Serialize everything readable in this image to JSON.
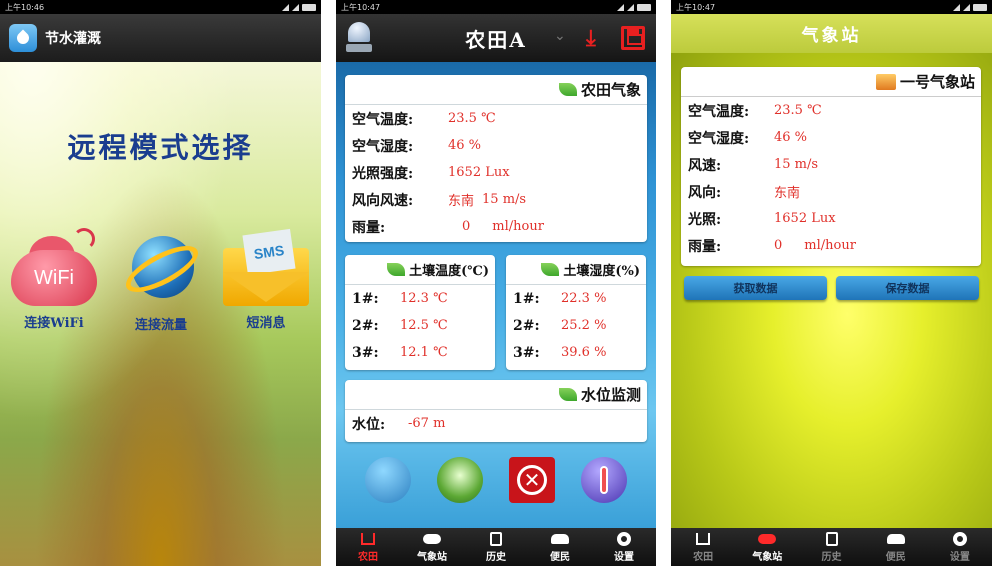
{
  "phone1": {
    "status_time": "上午10:46",
    "app_title": "节水灌溉",
    "heading": "远程模式选择",
    "options": [
      {
        "label": "连接WiFi",
        "icon_text": "WiFi",
        "icon": "wifi-cloud-icon"
      },
      {
        "label": "连接流量",
        "icon": "globe-icon"
      },
      {
        "label": "短消息",
        "icon_text": "SMS",
        "icon": "sms-envelope-icon"
      }
    ],
    "colors": {
      "heading": "#1a3d8f"
    }
  },
  "phone2": {
    "status_time": "上午10:47",
    "title": "农田A",
    "dropdown_glyph": "⌄",
    "download_glyph": "⤓",
    "weather": {
      "title": "农田气象",
      "rows": [
        {
          "k": "空气温度:",
          "v": "23.5 ℃"
        },
        {
          "k": "空气湿度:",
          "v": "46 %"
        },
        {
          "k": "光照强度:",
          "v": "1652 Lux"
        },
        {
          "k": "风向风速:",
          "v": "东南",
          "u": "15 m/s"
        },
        {
          "k": "雨量:",
          "v": "0",
          "u": "ml/hour"
        }
      ]
    },
    "soil_temp": {
      "title": "土壤温度(℃)",
      "rows": [
        {
          "k": "1#:",
          "v": "12.3 ℃"
        },
        {
          "k": "2#:",
          "v": "12.5 ℃"
        },
        {
          "k": "3#:",
          "v": "12.1 ℃"
        }
      ]
    },
    "soil_humid": {
      "title": "土壤湿度(%)",
      "rows": [
        {
          "k": "1#:",
          "v": "22.3 %"
        },
        {
          "k": "2#:",
          "v": "25.2 %"
        },
        {
          "k": "3#:",
          "v": "39.6 %"
        }
      ]
    },
    "water": {
      "title": "水位监测",
      "rows": [
        {
          "k": "水位:",
          "v": "-67 m"
        }
      ]
    },
    "stop_glyph": "✕",
    "tabs": [
      {
        "label": "农田",
        "icon": "home-icon",
        "active": true
      },
      {
        "label": "气象站",
        "icon": "cloud-icon"
      },
      {
        "label": "历史",
        "icon": "clipboard-icon"
      },
      {
        "label": "便民",
        "icon": "people-icon"
      },
      {
        "label": "设置",
        "icon": "gear-icon"
      }
    ],
    "colors": {
      "value": "#e0302a",
      "accent": "#e82020"
    }
  },
  "phone3": {
    "status_time": "上午10:47",
    "title": "气象站",
    "station": {
      "title": "一号气象站",
      "rows": [
        {
          "k": "空气温度:",
          "v": "23.5 ℃"
        },
        {
          "k": "空气湿度:",
          "v": "46 %"
        },
        {
          "k": "风速:",
          "v": "15 m/s"
        },
        {
          "k": "风向:",
          "v": "东南"
        },
        {
          "k": "光照:",
          "v": "1652 Lux"
        },
        {
          "k": "雨量:",
          "v": "0",
          "u": "ml/hour"
        }
      ]
    },
    "btn_fetch": "获取数据",
    "btn_save": "保存数据",
    "tabs": [
      {
        "label": "农田",
        "icon": "home-icon"
      },
      {
        "label": "气象站",
        "icon": "cloud-icon",
        "active": true
      },
      {
        "label": "历史",
        "icon": "clipboard-icon"
      },
      {
        "label": "便民",
        "icon": "people-icon"
      },
      {
        "label": "设置",
        "icon": "gear-icon"
      }
    ]
  }
}
